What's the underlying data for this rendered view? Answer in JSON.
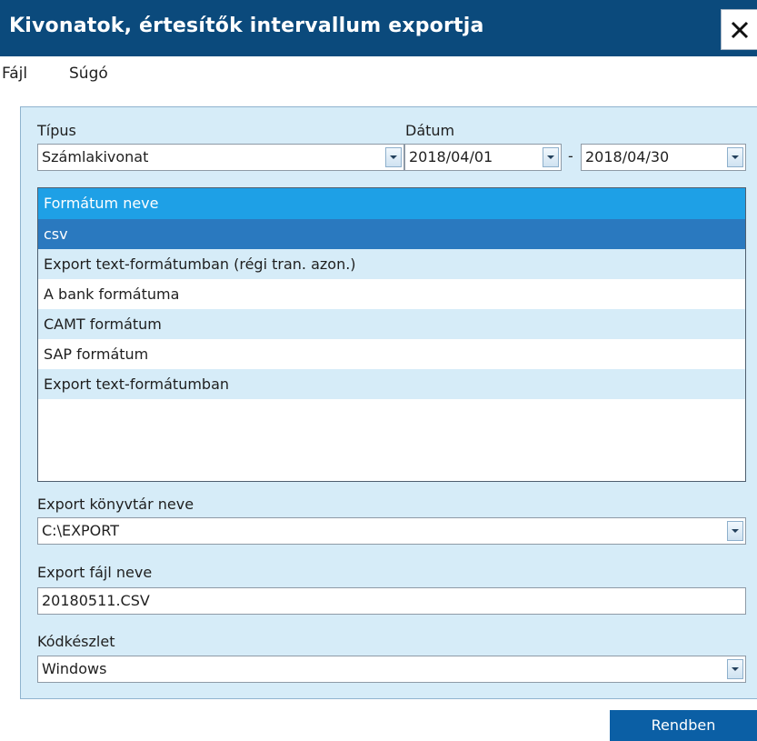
{
  "window": {
    "title": "Kivonatok, értesítők intervallum exportja"
  },
  "menu": {
    "items": [
      "Fájl",
      "Súgó"
    ]
  },
  "form": {
    "type_label": "Típus",
    "type_value": "Számlakivonat",
    "date_label": "Dátum",
    "date_from": "2018/04/01",
    "date_separator": "-",
    "date_to": "2018/04/30",
    "format_list": {
      "header": "Formátum neve",
      "items": [
        "csv",
        "Export text-formátumban (régi tran. azon.)",
        "A bank formátuma",
        "CAMT formátum",
        "SAP formátum",
        "Export text-formátumban"
      ],
      "selected_item": "csv"
    },
    "export_dir_label": "Export könyvtár neve",
    "export_dir_value": "C:\\EXPORT",
    "export_file_label": "Export fájl neve",
    "export_file_value": "20180511.CSV",
    "charset_label": "Kódkészlet",
    "charset_value": "Windows"
  },
  "buttons": {
    "ok": "Rendben",
    "close_icon": "close-icon"
  },
  "colors": {
    "titlebar": "#0b4a7c",
    "panel": "#d6ecf8",
    "list_header": "#1ea0e6",
    "selected_row": "#2a79bf",
    "ok_button": "#0b5fa5"
  }
}
